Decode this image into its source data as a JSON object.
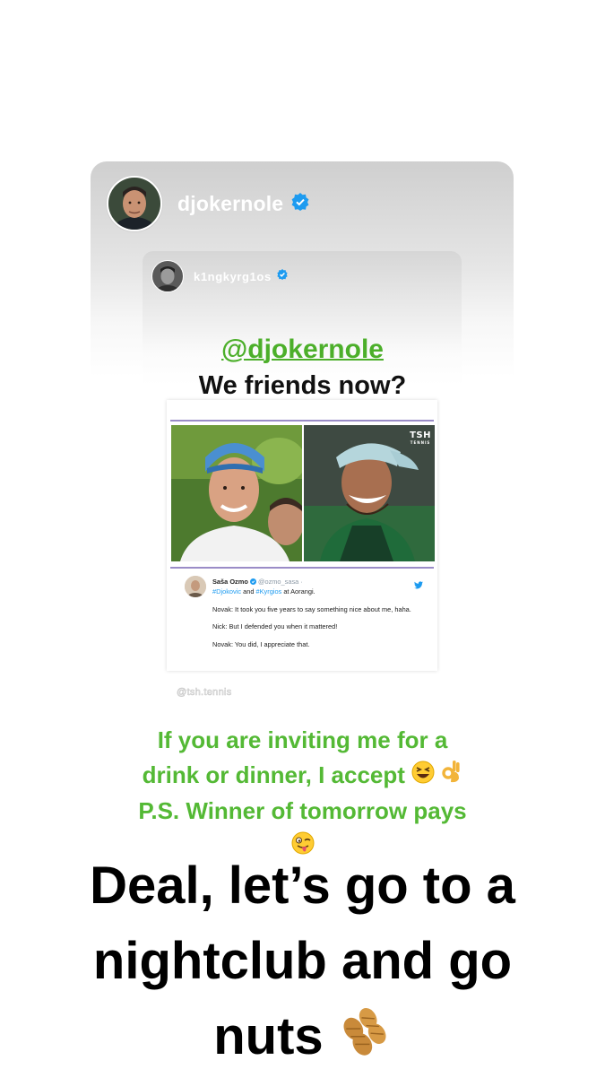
{
  "shared_story": {
    "username": "djokernole",
    "verified": true
  },
  "inner_story": {
    "username": "k1ngkyrg1os",
    "verified": true,
    "mention": "@djokernole",
    "question": "We friends now?",
    "post": {
      "logo_text": "TSH",
      "logo_sub": "TENNIS",
      "tweet": {
        "name": "Saša Ozmo",
        "handle": "@ozmo_sasa ·",
        "hashtag_1": "#Djokovic",
        "and": " and ",
        "hashtag_2": "#Kyrgios",
        "location": " at Aorangi.",
        "line_1": "Novak: It took you five years to say something nice about me, haha.",
        "line_2": "Nick: But I defended you when it mattered!",
        "line_3": "Novak: You did, I appreciate that."
      }
    },
    "watermark": "@tsh.tennis"
  },
  "reply_green": {
    "line_1": "If you are inviting me for a",
    "line_2": "drink or dinner, I accept",
    "line_3": "P.S. Winner of tomorrow pays"
  },
  "reply_black": {
    "line_1": "Deal, let’s go to a",
    "line_2": "nightclub and go",
    "line_3": "nuts"
  },
  "icons": [
    "verified-badge-icon",
    "twitter-bird-icon",
    "laughing-face-emoji",
    "ok-hand-emoji",
    "winking-tongue-face-emoji",
    "peanuts-emoji"
  ],
  "colors": {
    "green_text": "#54b935",
    "verified_blue": "#1d9bf0"
  }
}
